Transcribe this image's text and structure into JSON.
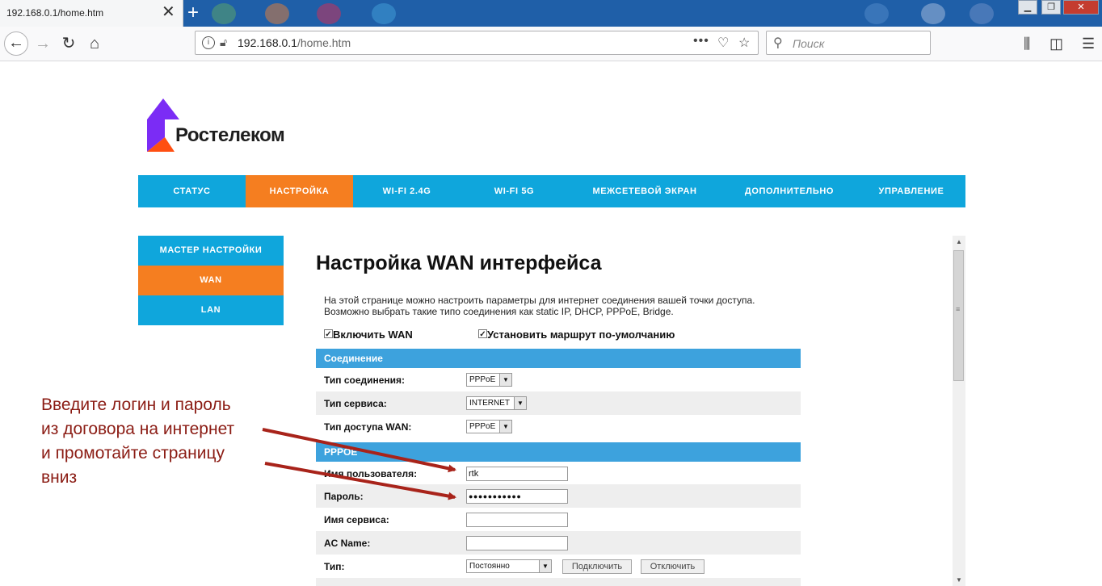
{
  "browser": {
    "tab_title": "192.168.0.1/home.htm",
    "tab_close": "✕",
    "new_tab": "+",
    "url_host": "192.168.0.1",
    "url_path": "/home.htm",
    "search_placeholder": "Поиск",
    "icons": [
      "back-arrow-icon",
      "forward-arrow-icon",
      "reload-icon",
      "home-icon",
      "info-icon",
      "insecure-lock-icon",
      "page-actions-icon",
      "pocket-icon",
      "bookmark-star-icon",
      "search-icon",
      "library-icon",
      "sidebar-icon",
      "menu-icon"
    ]
  },
  "logo": {
    "text": "Ростелеком",
    "colors": [
      "#7b2cf5",
      "#ff4f12"
    ]
  },
  "main_nav": [
    {
      "label": "СТАТУС",
      "active": false
    },
    {
      "label": "НАСТРОЙКА",
      "active": true
    },
    {
      "label": "WI-FI 2.4G",
      "active": false
    },
    {
      "label": "WI-FI 5G",
      "active": false
    },
    {
      "label": "МЕЖСЕТЕВОЙ ЭКРАН",
      "active": false
    },
    {
      "label": "ДОПОЛНИТЕЛЬНО",
      "active": false
    },
    {
      "label": "УПРАВЛЕНИЕ",
      "active": false
    }
  ],
  "side_menu": [
    {
      "label": "МАСТЕР НАСТРОЙКИ",
      "active": false
    },
    {
      "label": "WAN",
      "active": true
    },
    {
      "label": "LAN",
      "active": false
    }
  ],
  "content": {
    "title": "Настройка WAN интерфейса",
    "desc_line1": "На этой странице можно настроить параметры для интернет соединения вашей точки доступа.",
    "desc_line2": "Возможно выбрать такие типо соединения как static IP, DHCP, PPPoE, Bridge.",
    "enable_wan": {
      "label": "Включить WAN",
      "checked": true
    },
    "default_route": {
      "label": "Установить маршрут по-умолчанию",
      "checked": true
    },
    "section_connection": "Соединение",
    "connection_type": {
      "label": "Тип соединения:",
      "value": "PPPoE"
    },
    "service_type": {
      "label": "Тип сервиса:",
      "value": "INTERNET"
    },
    "wan_access_type": {
      "label": "Тип доступа WAN:",
      "value": "PPPoE"
    },
    "section_pppoe": "PPPOE",
    "username": {
      "label": "Имя пользователя:",
      "value": "rtk"
    },
    "password": {
      "label": "Пароль:",
      "value": "●●●●●●●●●●●"
    },
    "service_name": {
      "label": "Имя сервиса:",
      "value": ""
    },
    "ac_name": {
      "label": "AC Name:",
      "value": ""
    },
    "type": {
      "label": "Тип:",
      "value": "Постоянно"
    },
    "connect_button": "Подключить",
    "disconnect_button": "Отключить"
  },
  "annotation": {
    "line1": "Введите логин и пароль",
    "line2": "из договора на интернет",
    "line3": "и промотайте страницу",
    "line4": "вниз",
    "color": "#8b1c14"
  }
}
